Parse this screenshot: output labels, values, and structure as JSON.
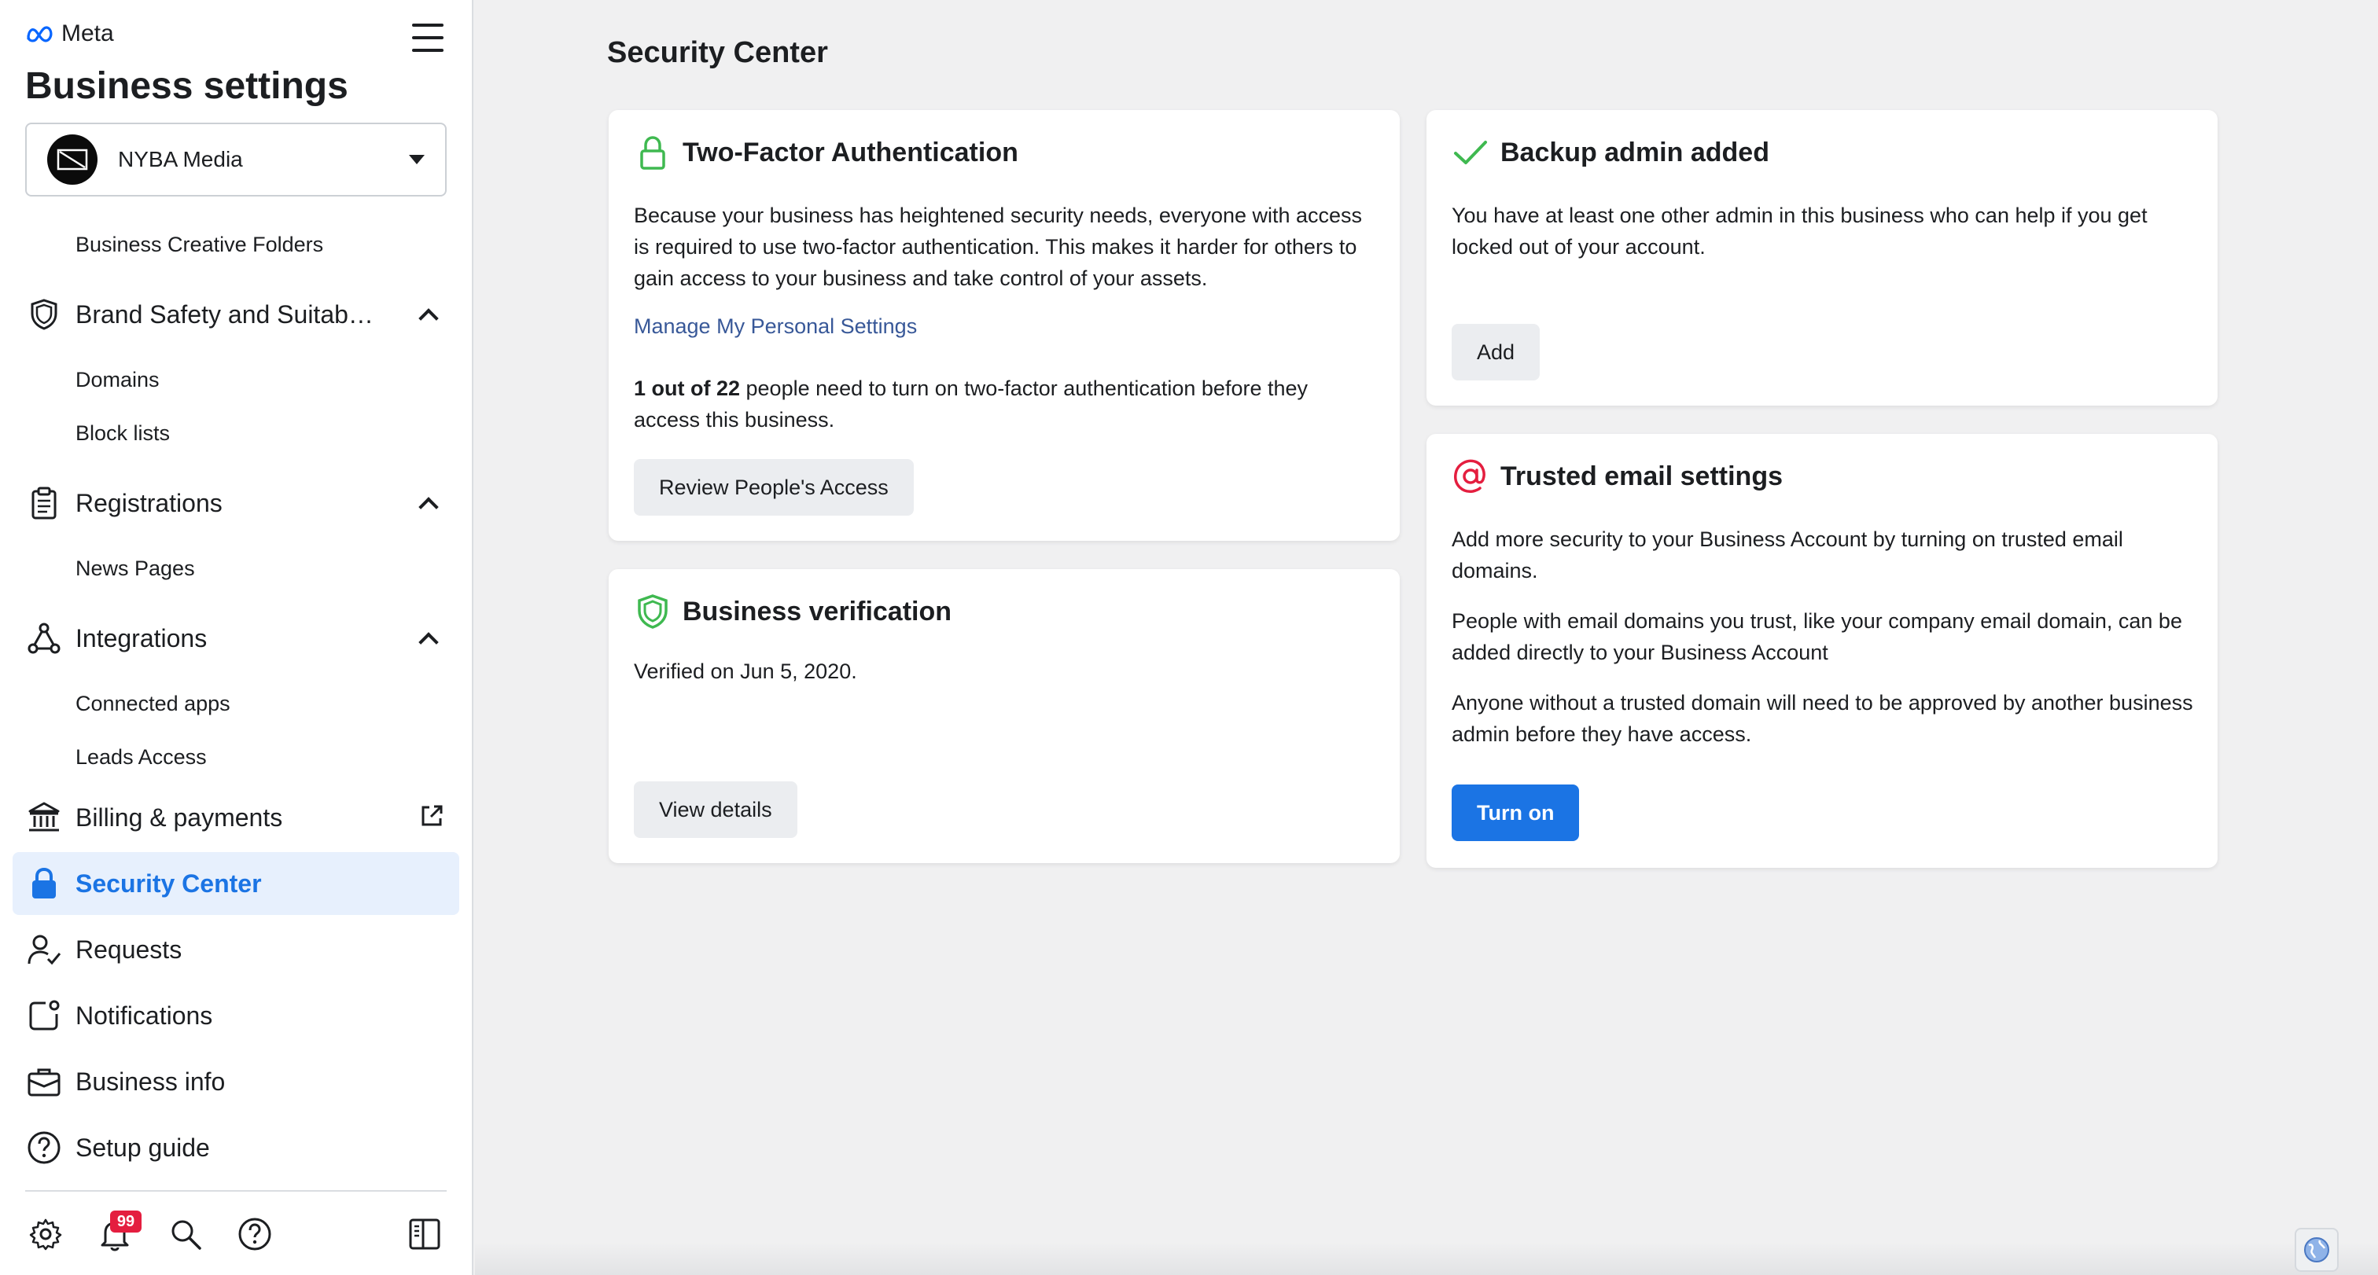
{
  "sidebar": {
    "brand": "Meta",
    "title": "Business settings",
    "account_name": "NYBA Media",
    "items": {
      "business_creative_folders": "Business Creative Folders",
      "brand_safety": "Brand Safety and Suitabi...",
      "domains": "Domains",
      "block_lists": "Block lists",
      "registrations": "Registrations",
      "news_pages": "News Pages",
      "integrations": "Integrations",
      "connected_apps": "Connected apps",
      "leads_access": "Leads Access",
      "billing": "Billing & payments",
      "security_center": "Security Center",
      "requests": "Requests",
      "notifications": "Notifications",
      "business_info": "Business info",
      "setup_guide": "Setup guide"
    },
    "notification_count": "99"
  },
  "main": {
    "page_title": "Security Center",
    "two_factor": {
      "title": "Two-Factor Authentication",
      "description": "Because your business has heightened security needs, everyone with access is required to use two-factor authentication. This makes it harder for others to gain access to your business and take control of your assets.",
      "link": "Manage My Personal Settings",
      "count_bold": "1 out of 22",
      "count_rest": " people need to turn on two-factor authentication before they access this business.",
      "button": "Review People's Access"
    },
    "verification": {
      "title": "Business verification",
      "text": "Verified on Jun 5, 2020.",
      "button": "View details"
    },
    "backup_admin": {
      "title": "Backup admin added",
      "text": "You have at least one other admin in this business who can help if you get locked out of your account.",
      "button": "Add"
    },
    "trusted_email": {
      "title": "Trusted email settings",
      "p1": "Add more security to your Business Account by turning on trusted email domains.",
      "p2": "People with email domains you trust, like your company email domain, can be added directly to your Business Account",
      "p3": "Anyone without a trusted domain will need to be approved by another business admin before they have access.",
      "button": "Turn on"
    }
  },
  "colors": {
    "accent": "#1b74e4",
    "active_bg": "#e7f0fd",
    "success": "#3fb950",
    "danger": "#e41e3f",
    "link": "#385898"
  },
  "icons": [
    "meta-logo-icon",
    "hamburger-icon",
    "shield-icon",
    "clipboard-icon",
    "integrations-icon",
    "bank-icon",
    "external-link-icon",
    "lock-icon",
    "person-check-icon",
    "notification-icon",
    "briefcase-icon",
    "question-icon",
    "gear-icon",
    "bell-icon",
    "search-icon",
    "help-icon",
    "panel-icon",
    "checkmark-icon",
    "at-sign-icon",
    "globe-icon"
  ]
}
